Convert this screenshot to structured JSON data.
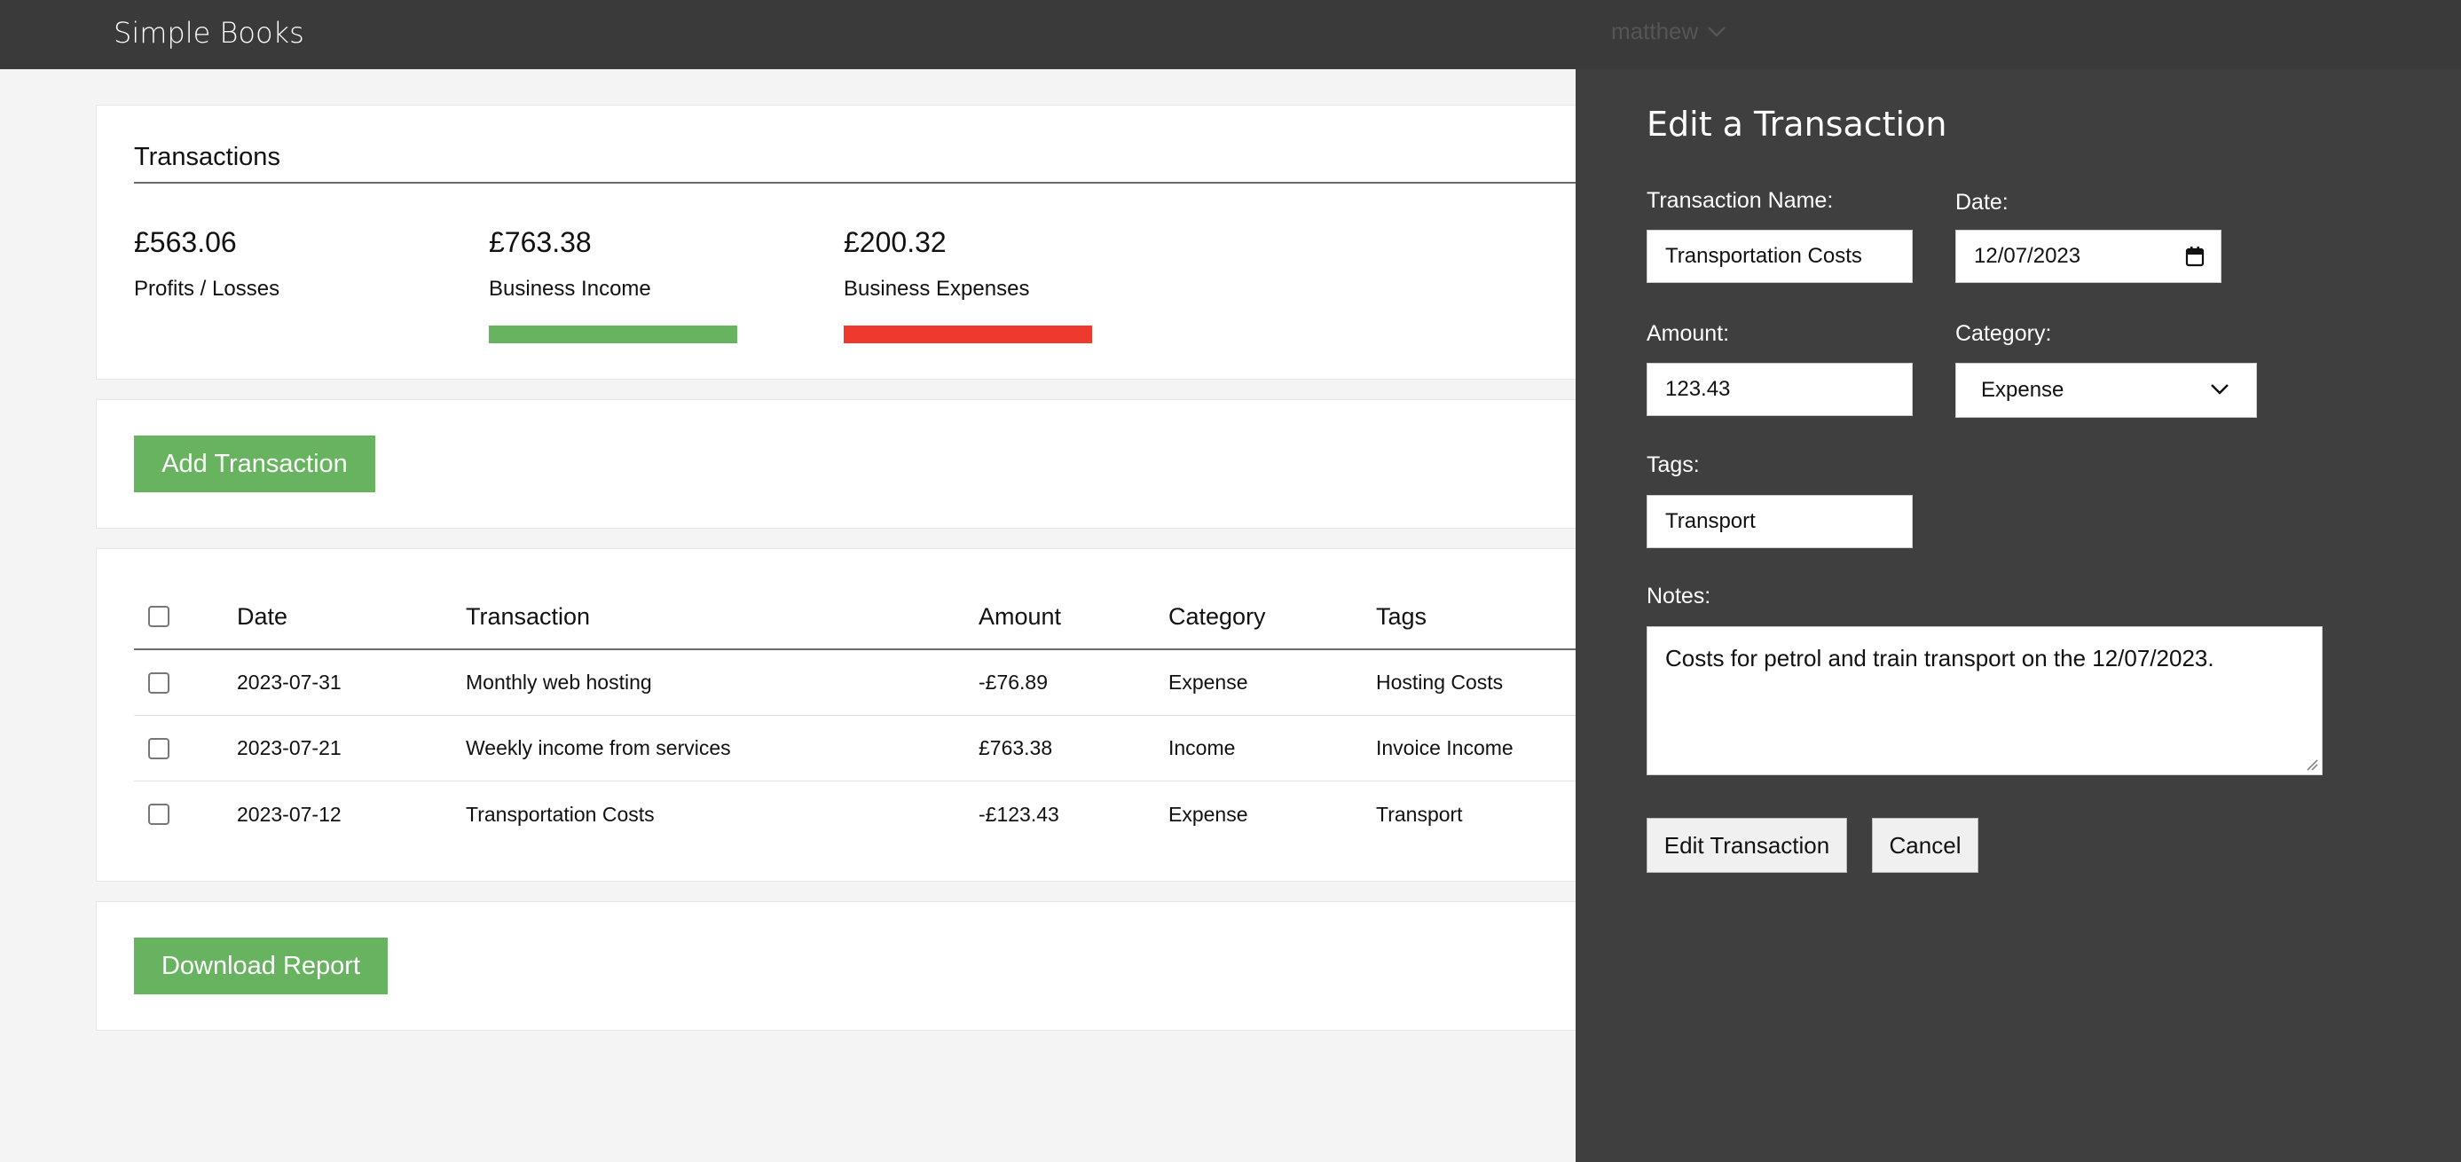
{
  "app": {
    "title": "Simple Books",
    "user": "matthew"
  },
  "summary": {
    "title": "Transactions",
    "profits": {
      "value": "£563.06",
      "label": "Profits / Losses"
    },
    "income": {
      "value": "£763.38",
      "label": "Business Income",
      "color": "#67b360"
    },
    "expenses": {
      "value": "£200.32",
      "label": "Business Expenses",
      "color": "#ee3a2e"
    }
  },
  "actions": {
    "add_label": "Add Transaction",
    "download_label": "Download Report"
  },
  "table": {
    "headers": {
      "date": "Date",
      "transaction": "Transaction",
      "amount": "Amount",
      "category": "Category",
      "tags": "Tags"
    },
    "rows": [
      {
        "date": "2023-07-31",
        "transaction": "Monthly web hosting",
        "amount": "-£76.89",
        "category": "Expense",
        "tags": "Hosting Costs"
      },
      {
        "date": "2023-07-21",
        "transaction": "Weekly income from services",
        "amount": "£763.38",
        "category": "Income",
        "tags": "Invoice Income"
      },
      {
        "date": "2023-07-12",
        "transaction": "Transportation Costs",
        "amount": "-£123.43",
        "category": "Expense",
        "tags": "Transport"
      }
    ]
  },
  "edit_panel": {
    "title": "Edit a Transaction",
    "name_label": "Transaction Name:",
    "name_value": "Transportation Costs",
    "date_label": "Date:",
    "date_value": "12/07/2023",
    "amount_label": "Amount:",
    "amount_value": "123.43",
    "category_label": "Category:",
    "category_value": "Expense",
    "tags_label": "Tags:",
    "tags_value": "Transport",
    "notes_label": "Notes:",
    "notes_value": "Costs for petrol and train transport on the 12/07/2023.",
    "submit_label": "Edit Transaction",
    "cancel_label": "Cancel"
  }
}
